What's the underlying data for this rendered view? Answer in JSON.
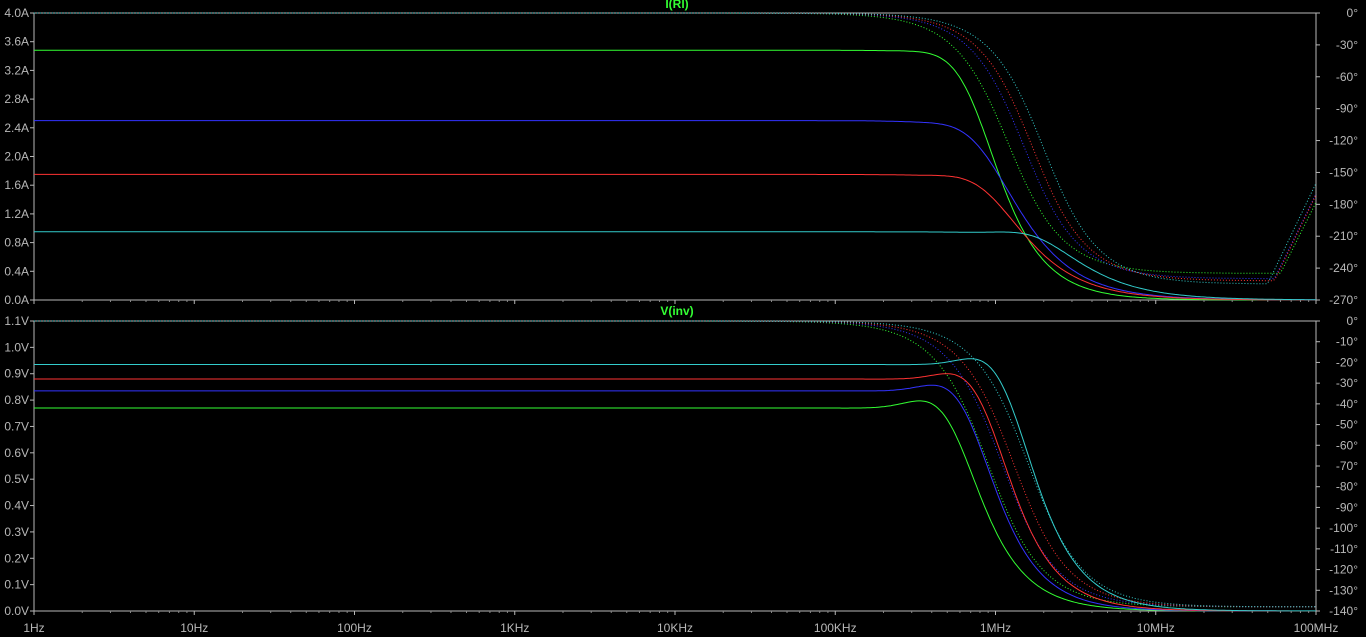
{
  "chart_data": [
    {
      "type": "line",
      "title": "I(Rl)",
      "x_scale": "log",
      "x_range_hz": [
        1,
        100000000
      ],
      "x_ticks": [
        "1Hz",
        "10Hz",
        "100Hz",
        "1KHz",
        "10KHz",
        "100KHz",
        "1MHz",
        "10MHz",
        "100MHz"
      ],
      "left_axis": {
        "ylim": [
          0,
          4.0
        ],
        "ticks": [
          "0.0A",
          "0.4A",
          "0.8A",
          "1.2A",
          "1.6A",
          "2.0A",
          "2.4A",
          "2.8A",
          "3.2A",
          "3.6A",
          "4.0A"
        ]
      },
      "right_axis": {
        "ylim": [
          -270,
          0
        ],
        "ticks": [
          "-270°",
          "-240°",
          "-210°",
          "-180°",
          "-150°",
          "-120°",
          "-90°",
          "-60°",
          "-30°",
          "0°"
        ]
      },
      "grid": false,
      "series": [
        {
          "color": "#33ff33",
          "dc": 3.48,
          "fp": 800000,
          "peak": 0.075,
          "q": 1.0,
          "order": 2,
          "ph_fc": 1200000,
          "ph_order": 2,
          "ph_dip": -245,
          "ph_dip_f": 60000000
        },
        {
          "color": "#3333ff",
          "dc": 2.5,
          "fp": 1000000,
          "peak": 0.09,
          "q": 0.9,
          "order": 1.6,
          "ph_fc": 1500000,
          "ph_order": 2,
          "ph_dip": -250,
          "ph_dip_f": 55000000
        },
        {
          "color": "#ff3333",
          "dc": 1.75,
          "fp": 1100000,
          "peak": 0.085,
          "q": 0.9,
          "order": 1.6,
          "ph_fc": 1700000,
          "ph_order": 2,
          "ph_dip": -252,
          "ph_dip_f": 55000000
        },
        {
          "color": "#33cccc",
          "dc": 0.95,
          "fp": 2500000,
          "peak": 0.075,
          "q": 0.8,
          "order": 1.5,
          "ph_fc": 2000000,
          "ph_order": 2,
          "ph_dip": -255,
          "ph_dip_f": 50000000
        }
      ]
    },
    {
      "type": "line",
      "title": "V(inv)",
      "x_scale": "log",
      "x_range_hz": [
        1,
        100000000
      ],
      "x_ticks": [
        "1Hz",
        "10Hz",
        "100Hz",
        "1KHz",
        "10KHz",
        "100KHz",
        "1MHz",
        "10MHz",
        "100MHz"
      ],
      "left_axis": {
        "ylim": [
          0,
          1.1
        ],
        "ticks": [
          "0.0V",
          "0.1V",
          "0.2V",
          "0.3V",
          "0.4V",
          "0.5V",
          "0.6V",
          "0.7V",
          "0.8V",
          "0.9V",
          "1.0V",
          "1.1V"
        ]
      },
      "right_axis": {
        "ylim": [
          -140,
          0
        ],
        "ticks": [
          "-140°",
          "-130°",
          "-120°",
          "-110°",
          "-100°",
          "-90°",
          "-80°",
          "-70°",
          "-60°",
          "-50°",
          "-40°",
          "-30°",
          "-20°",
          "-10°",
          "0°"
        ]
      },
      "grid": false,
      "series": [
        {
          "color": "#33ff33",
          "dc": 0.77,
          "fp": 650000,
          "peak": 0.075,
          "q": 1.0,
          "order": 2,
          "ph_fc": 900000,
          "ph_order": 2,
          "ph_dip": -138,
          "ph_dip_f": 25000000
        },
        {
          "color": "#3333ff",
          "dc": 0.835,
          "fp": 800000,
          "peak": 0.07,
          "q": 0.9,
          "order": 2,
          "ph_fc": 1100000,
          "ph_order": 2,
          "ph_dip": -138,
          "ph_dip_f": 25000000
        },
        {
          "color": "#ff3333",
          "dc": 0.88,
          "fp": 1000000,
          "peak": 0.07,
          "q": 0.9,
          "order": 2,
          "ph_fc": 1300000,
          "ph_order": 2,
          "ph_dip": -138,
          "ph_dip_f": 25000000
        },
        {
          "color": "#33cccc",
          "dc": 0.935,
          "fp": 1400000,
          "peak": 0.075,
          "q": 0.9,
          "order": 2,
          "ph_fc": 1600000,
          "ph_order": 2,
          "ph_dip": -138,
          "ph_dip_f": 25000000
        }
      ]
    }
  ]
}
